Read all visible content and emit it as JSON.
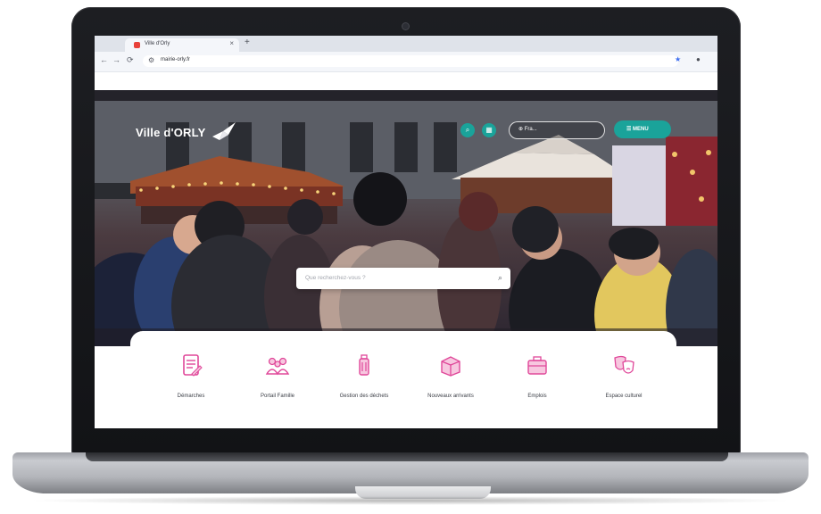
{
  "browser": {
    "tab_title": "Ville d'Orly",
    "tab_close": "×",
    "new_tab": "+",
    "back": "←",
    "forward": "→",
    "reload": "⟳",
    "url": "mairie-orly.fr",
    "star_icon": "star-icon",
    "profile_icon": "profile-icon"
  },
  "site": {
    "logo_text": "Ville d'ORLY",
    "language_select": "⊕ Fra...",
    "menu_label": "☰ MENU",
    "search_placeholder": "Que recherchez-vous ?",
    "accent_color": "#1aa39a",
    "pink_color": "#e0489a"
  },
  "carousel": {
    "slide_count": 6,
    "active_slide": 1
  },
  "quick_access": [
    {
      "label": "Démarches",
      "icon": "document-icon"
    },
    {
      "label": "Portail Famille",
      "icon": "family-icon"
    },
    {
      "label": "Gestion des déchets",
      "icon": "recycle-bin-icon"
    },
    {
      "label": "Nouveaux arrivants",
      "icon": "moving-box-icon"
    },
    {
      "label": "Emplois",
      "icon": "briefcase-icon"
    },
    {
      "label": "Espace culturel",
      "icon": "theatre-masks-icon"
    }
  ]
}
